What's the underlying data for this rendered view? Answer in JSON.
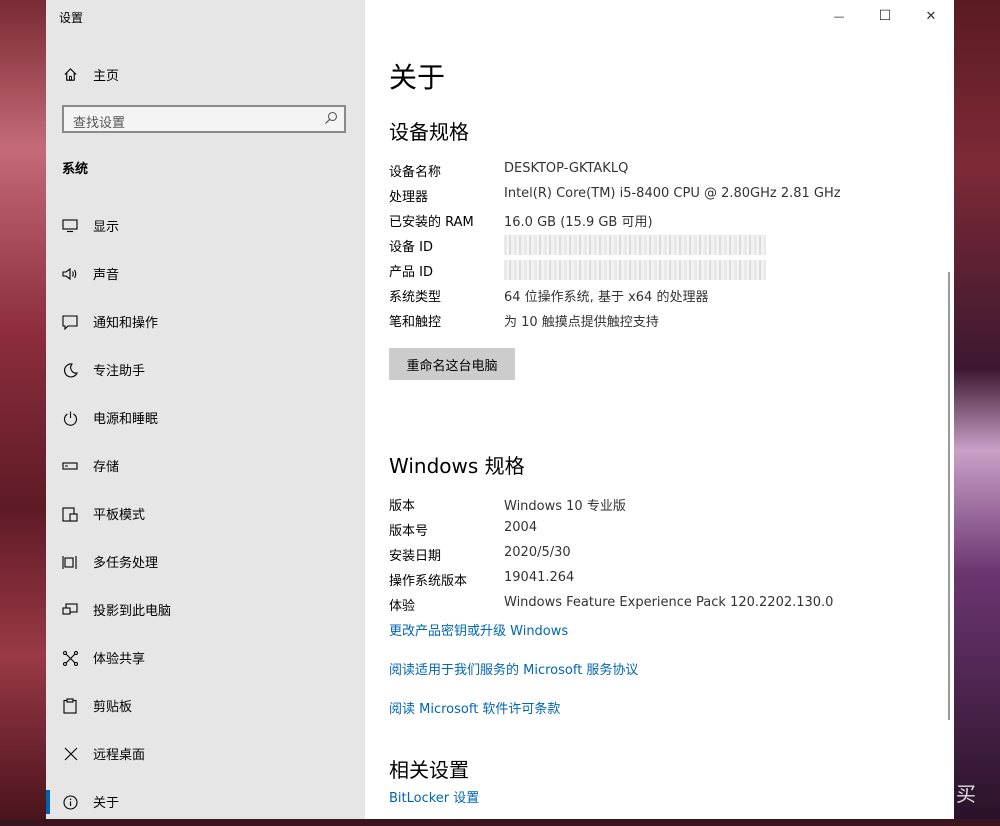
{
  "window": {
    "title": "设置"
  },
  "controls": {
    "minimize": "—",
    "maximize": "☐",
    "close": "✕"
  },
  "sidebar": {
    "home": {
      "label": "主页",
      "icon": "home-icon"
    },
    "search": {
      "placeholder": "查找设置"
    },
    "section_title": "系统",
    "items": [
      {
        "label": "显示",
        "icon": "display-icon"
      },
      {
        "label": "声音",
        "icon": "sound-icon"
      },
      {
        "label": "通知和操作",
        "icon": "notification-icon"
      },
      {
        "label": "专注助手",
        "icon": "moon-icon"
      },
      {
        "label": "电源和睡眠",
        "icon": "power-icon"
      },
      {
        "label": "存储",
        "icon": "storage-icon"
      },
      {
        "label": "平板模式",
        "icon": "tablet-icon"
      },
      {
        "label": "多任务处理",
        "icon": "multitask-icon"
      },
      {
        "label": "投影到此电脑",
        "icon": "project-icon"
      },
      {
        "label": "体验共享",
        "icon": "share-icon"
      },
      {
        "label": "剪贴板",
        "icon": "clipboard-icon"
      },
      {
        "label": "远程桌面",
        "icon": "remote-icon"
      },
      {
        "label": "关于",
        "icon": "info-icon",
        "selected": true
      }
    ]
  },
  "main": {
    "page_title": "关于",
    "device_specs": {
      "heading": "设备规格",
      "rows": [
        {
          "key": "设备名称",
          "value": "DESKTOP-GKTAKLQ"
        },
        {
          "key": "处理器",
          "value": "Intel(R) Core(TM) i5-8400 CPU @ 2.80GHz   2.81 GHz"
        },
        {
          "key": "已安装的 RAM",
          "value": "16.0 GB (15.9 GB 可用)"
        },
        {
          "key": "设备 ID",
          "value": ""
        },
        {
          "key": "产品 ID",
          "value": ""
        },
        {
          "key": "系统类型",
          "value": "64 位操作系统, 基于 x64 的处理器"
        },
        {
          "key": "笔和触控",
          "value": "为 10 触摸点提供触控支持"
        }
      ],
      "rename_button": "重命名这台电脑"
    },
    "windows_specs": {
      "heading": "Windows 规格",
      "rows": [
        {
          "key": "版本",
          "value": "Windows 10 专业版"
        },
        {
          "key": "版本号",
          "value": "2004"
        },
        {
          "key": "安装日期",
          "value": "2020/5/30"
        },
        {
          "key": "操作系统版本",
          "value": "19041.264"
        },
        {
          "key": "体验",
          "value": "Windows Feature Experience Pack 120.2202.130.0"
        }
      ],
      "links": [
        "更改产品密钥或升级 Windows",
        "阅读适用于我们服务的 Microsoft 服务协议",
        "阅读 Microsoft 软件许可条款"
      ]
    },
    "related": {
      "heading": "相关设置",
      "link": "BitLocker 设置"
    }
  },
  "watermark": "什么值得买",
  "accent": "#0063b1",
  "link_color": "#0066b4"
}
